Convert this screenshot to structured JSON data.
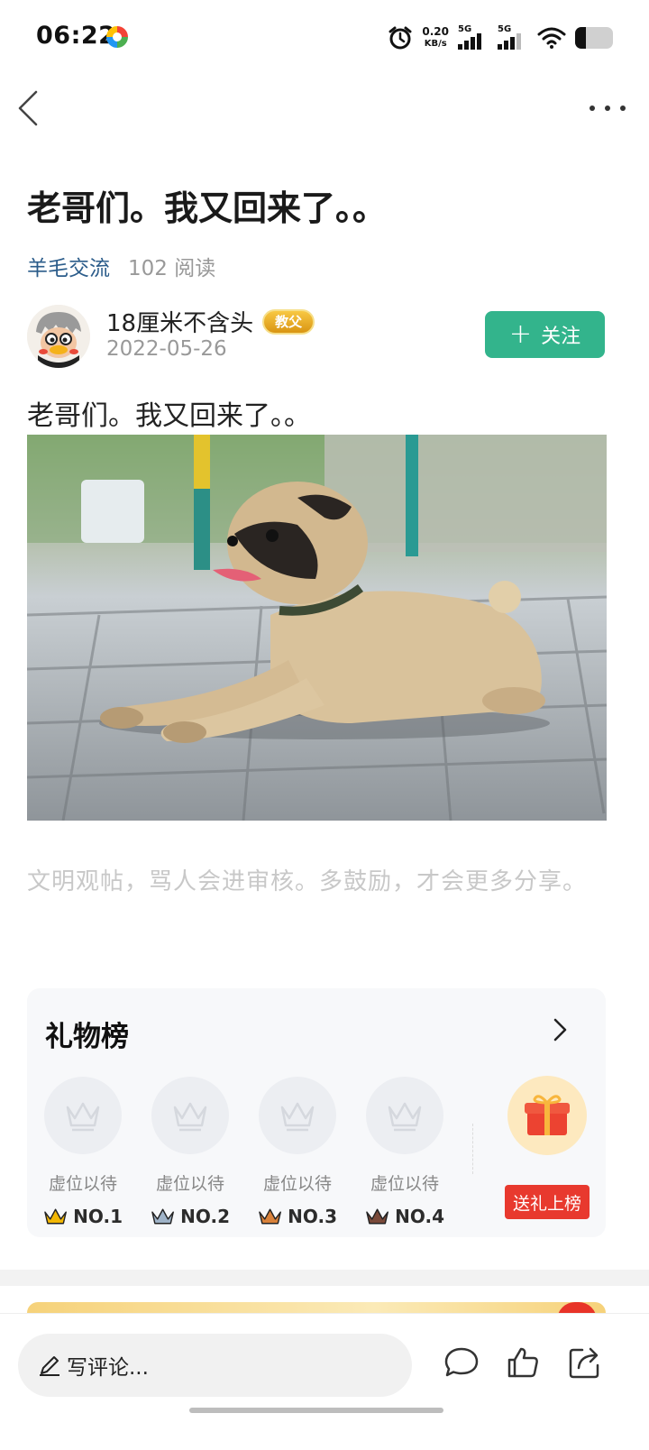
{
  "status_bar": {
    "time": "06:22",
    "net_speed": "0.20",
    "net_unit": "KB/s",
    "sim1": "5G",
    "sim2": "5G",
    "icons": [
      "alarm-icon",
      "wifi-icon",
      "battery-icon"
    ]
  },
  "nav": {
    "back_icon": "back-chevron-icon",
    "more_icon": "more-dots-icon"
  },
  "post": {
    "title": "老哥们。我又回来了。。",
    "channel": "羊毛交流",
    "reads": "102 阅读",
    "author": {
      "name": "18厘米不含头",
      "badge": "教父",
      "date": "2022-05-26"
    },
    "follow_label": "关注",
    "body": "老哥们。我又回来了。。",
    "image_alt": "pug lying on pavement",
    "notice": "文明观帖，骂人会进审核。多鼓励，才会更多分享。"
  },
  "gift_board": {
    "title": "礼物榜",
    "slots": [
      {
        "label": "虚位以待",
        "rank": "NO.1",
        "crown_color": "#f2b705"
      },
      {
        "label": "虚位以待",
        "rank": "NO.2",
        "crown_color": "#9fb3c8"
      },
      {
        "label": "虚位以待",
        "rank": "NO.3",
        "crown_color": "#d9823b"
      },
      {
        "label": "虚位以待",
        "rank": "NO.4",
        "crown_color": "#7a4a3a"
      }
    ],
    "send_label": "送礼上榜"
  },
  "bottom_bar": {
    "comment_placeholder": "写评论..."
  },
  "colors": {
    "accent_green": "#33b48c",
    "channel_blue": "#2b5c8a",
    "send_red": "#e8392e"
  }
}
